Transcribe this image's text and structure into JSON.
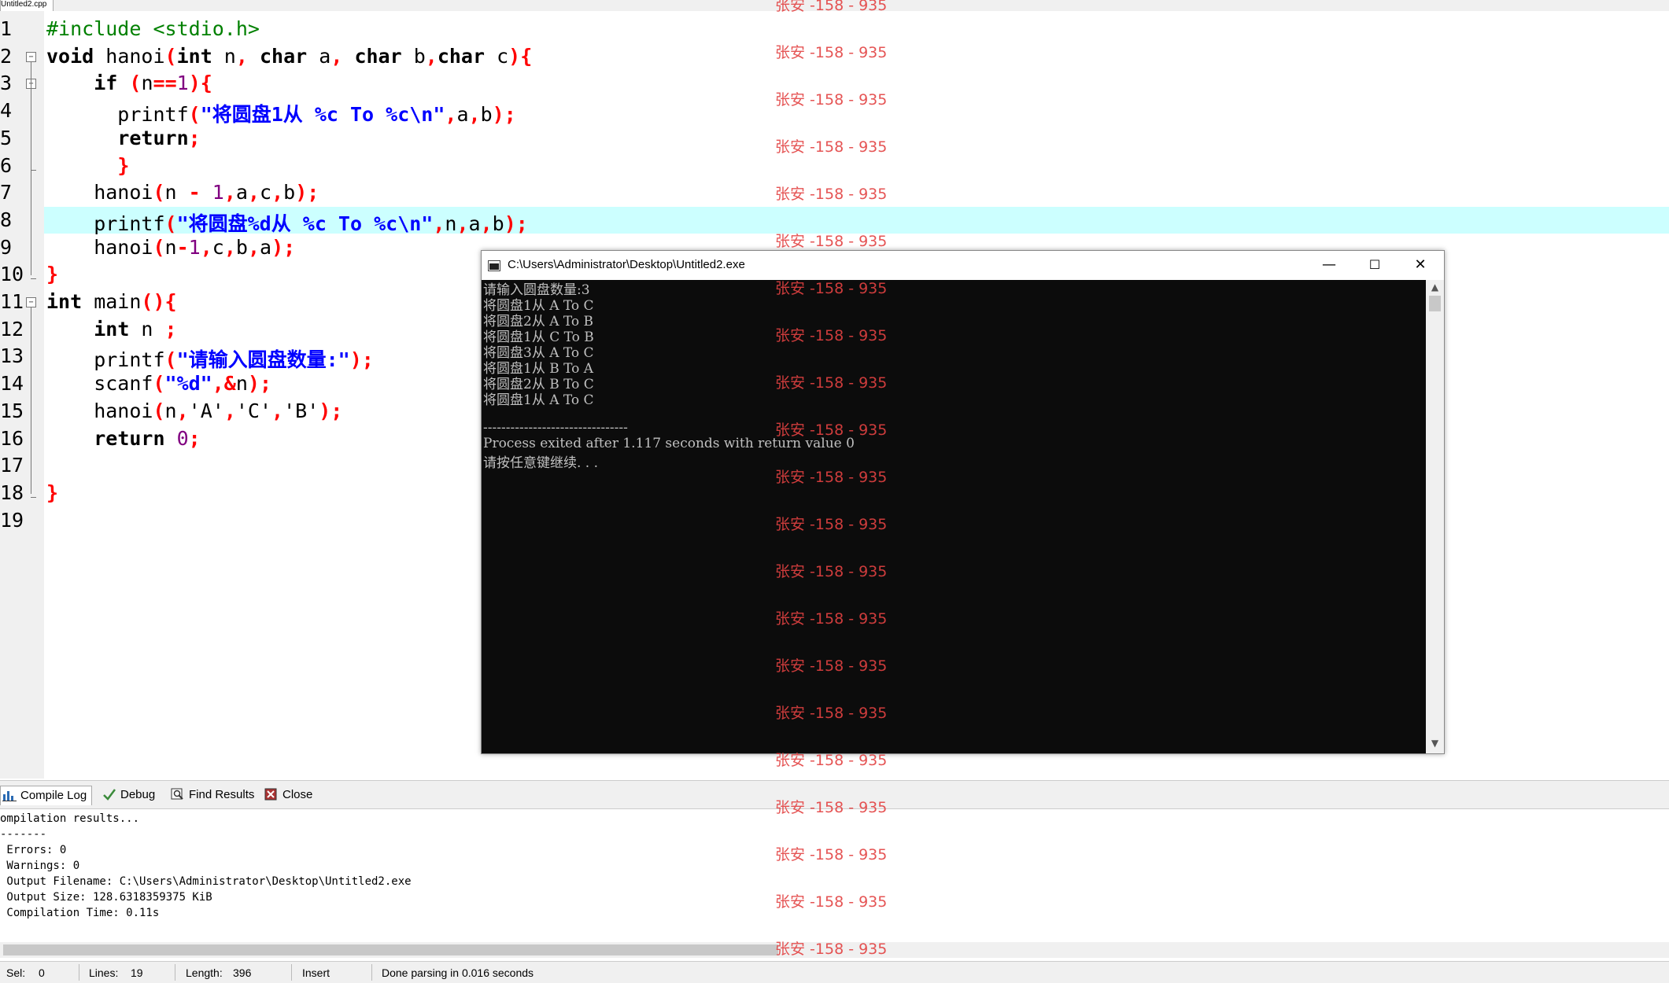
{
  "editor": {
    "tab_title": "Untitled2.cpp",
    "line_numbers": [
      "1",
      "2",
      "3",
      "4",
      "5",
      "6",
      "7",
      "8",
      "9",
      "10",
      "11",
      "12",
      "13",
      "14",
      "15",
      "16",
      "17",
      "18",
      "19"
    ],
    "fold_marker": "−"
  },
  "code_lines": [
    [
      {
        "t": "#include <stdio.h>",
        "c": "pp"
      }
    ],
    [
      {
        "t": "void",
        "c": "kw"
      },
      {
        "t": " hanoi",
        "c": ""
      },
      {
        "t": "(",
        "c": "sym"
      },
      {
        "t": "int",
        "c": "kw"
      },
      {
        "t": " n",
        "c": ""
      },
      {
        "t": ",",
        "c": "sym"
      },
      {
        "t": " ",
        "c": ""
      },
      {
        "t": "char",
        "c": "kw"
      },
      {
        "t": " a",
        "c": ""
      },
      {
        "t": ",",
        "c": "sym"
      },
      {
        "t": " ",
        "c": ""
      },
      {
        "t": "char",
        "c": "kw"
      },
      {
        "t": " b",
        "c": ""
      },
      {
        "t": ",",
        "c": "sym"
      },
      {
        "t": "char",
        "c": "kw"
      },
      {
        "t": " c",
        "c": ""
      },
      {
        "t": "){",
        "c": "sym"
      }
    ],
    [
      {
        "t": "    ",
        "c": ""
      },
      {
        "t": "if",
        "c": "kw"
      },
      {
        "t": " ",
        "c": ""
      },
      {
        "t": "(",
        "c": "sym"
      },
      {
        "t": "n",
        "c": ""
      },
      {
        "t": "==",
        "c": "sym"
      },
      {
        "t": "1",
        "c": "num"
      },
      {
        "t": "){",
        "c": "sym"
      }
    ],
    [
      {
        "t": "      printf",
        "c": ""
      },
      {
        "t": "(",
        "c": "sym"
      },
      {
        "t": "\"将圆盘1从 %c To %c\\n\"",
        "c": "str"
      },
      {
        "t": ",",
        "c": "sym"
      },
      {
        "t": "a",
        "c": ""
      },
      {
        "t": ",",
        "c": "sym"
      },
      {
        "t": "b",
        "c": ""
      },
      {
        "t": ");",
        "c": "sym"
      }
    ],
    [
      {
        "t": "      ",
        "c": ""
      },
      {
        "t": "return",
        "c": "kw"
      },
      {
        "t": ";",
        "c": "sym"
      }
    ],
    [
      {
        "t": "      ",
        "c": ""
      },
      {
        "t": "}",
        "c": "sym"
      }
    ],
    [
      {
        "t": "    hanoi",
        "c": ""
      },
      {
        "t": "(",
        "c": "sym"
      },
      {
        "t": "n ",
        "c": ""
      },
      {
        "t": "-",
        "c": "sym"
      },
      {
        "t": " ",
        "c": ""
      },
      {
        "t": "1",
        "c": "num"
      },
      {
        "t": ",",
        "c": "sym"
      },
      {
        "t": "a",
        "c": ""
      },
      {
        "t": ",",
        "c": "sym"
      },
      {
        "t": "c",
        "c": ""
      },
      {
        "t": ",",
        "c": "sym"
      },
      {
        "t": "b",
        "c": ""
      },
      {
        "t": ");",
        "c": "sym"
      }
    ],
    [
      {
        "t": "    printf",
        "c": ""
      },
      {
        "t": "(",
        "c": "sym"
      },
      {
        "t": "\"将圆盘%d从 %c To %c\\n\"",
        "c": "str"
      },
      {
        "t": ",",
        "c": "sym"
      },
      {
        "t": "n",
        "c": ""
      },
      {
        "t": ",",
        "c": "sym"
      },
      {
        "t": "a",
        "c": ""
      },
      {
        "t": ",",
        "c": "sym"
      },
      {
        "t": "b",
        "c": ""
      },
      {
        "t": ");",
        "c": "sym"
      }
    ],
    [
      {
        "t": "    hanoi",
        "c": ""
      },
      {
        "t": "(",
        "c": "sym"
      },
      {
        "t": "n",
        "c": ""
      },
      {
        "t": "-",
        "c": "sym"
      },
      {
        "t": "1",
        "c": "num"
      },
      {
        "t": ",",
        "c": "sym"
      },
      {
        "t": "c",
        "c": ""
      },
      {
        "t": ",",
        "c": "sym"
      },
      {
        "t": "b",
        "c": ""
      },
      {
        "t": ",",
        "c": "sym"
      },
      {
        "t": "a",
        "c": ""
      },
      {
        "t": ");",
        "c": "sym"
      }
    ],
    [
      {
        "t": "}",
        "c": "sym"
      }
    ],
    [
      {
        "t": "int",
        "c": "kw"
      },
      {
        "t": " main",
        "c": ""
      },
      {
        "t": "(){",
        "c": "sym"
      }
    ],
    [
      {
        "t": "    ",
        "c": ""
      },
      {
        "t": "int",
        "c": "kw"
      },
      {
        "t": " n ",
        "c": ""
      },
      {
        "t": ";",
        "c": "sym"
      }
    ],
    [
      {
        "t": "    printf",
        "c": ""
      },
      {
        "t": "(",
        "c": "sym"
      },
      {
        "t": "\"请输入圆盘数量:\"",
        "c": "str"
      },
      {
        "t": ");",
        "c": "sym"
      }
    ],
    [
      {
        "t": "    scanf",
        "c": ""
      },
      {
        "t": "(",
        "c": "sym"
      },
      {
        "t": "\"%d\"",
        "c": "str"
      },
      {
        "t": ",&",
        "c": "sym"
      },
      {
        "t": "n",
        "c": ""
      },
      {
        "t": ");",
        "c": "sym"
      }
    ],
    [
      {
        "t": "    hanoi",
        "c": ""
      },
      {
        "t": "(",
        "c": "sym"
      },
      {
        "t": "n",
        "c": ""
      },
      {
        "t": ",",
        "c": "sym"
      },
      {
        "t": "'A'",
        "c": ""
      },
      {
        "t": ",",
        "c": "sym"
      },
      {
        "t": "'C'",
        "c": ""
      },
      {
        "t": ",",
        "c": "sym"
      },
      {
        "t": "'B'",
        "c": ""
      },
      {
        "t": ");",
        "c": "sym"
      }
    ],
    [
      {
        "t": "    ",
        "c": ""
      },
      {
        "t": "return",
        "c": "kw"
      },
      {
        "t": " ",
        "c": ""
      },
      {
        "t": "0",
        "c": "num"
      },
      {
        "t": ";",
        "c": "sym"
      }
    ],
    [
      {
        "t": "",
        "c": ""
      }
    ],
    [
      {
        "t": "}",
        "c": "sym"
      }
    ],
    [
      {
        "t": "",
        "c": ""
      }
    ]
  ],
  "console": {
    "title": "C:\\Users\\Administrator\\Desktop\\Untitled2.exe",
    "minimize": "—",
    "maximize": "☐",
    "close": "✕",
    "lines": [
      "请输入圆盘数量:3",
      "将圆盘1从 A To C",
      "将圆盘2从 A To B",
      "将圆盘1从 C To B",
      "将圆盘3从 A To C",
      "将圆盘1从 B To A",
      "将圆盘2从 B To C",
      "将圆盘1从 A To C",
      "",
      "--------------------------------",
      "Process exited after 1.117 seconds with return value 0",
      "请按任意键继续. . ."
    ],
    "scroll_up": "▲",
    "scroll_down": "▼"
  },
  "bottom_panel": {
    "tabs": [
      "Compile Log",
      "Debug",
      "Find Results",
      "Close"
    ],
    "log_lines": [
      "ompilation results...",
      "-------",
      " Errors: 0",
      " Warnings: 0",
      " Output Filename: C:\\Users\\Administrator\\Desktop\\Untitled2.exe",
      " Output Size: 128.6318359375 KiB",
      " Compilation Time: 0.11s"
    ]
  },
  "status_bar": {
    "sel_label": "Sel:",
    "sel_value": "0",
    "lines_label": "Lines:",
    "lines_value": "19",
    "length_label": "Length:",
    "length_value": "396",
    "mode": "Insert",
    "message": "Done parsing in 0.016 seconds"
  },
  "watermark": {
    "text": "张安 -158 - 935",
    "color": "#e34242",
    "count": 21
  }
}
